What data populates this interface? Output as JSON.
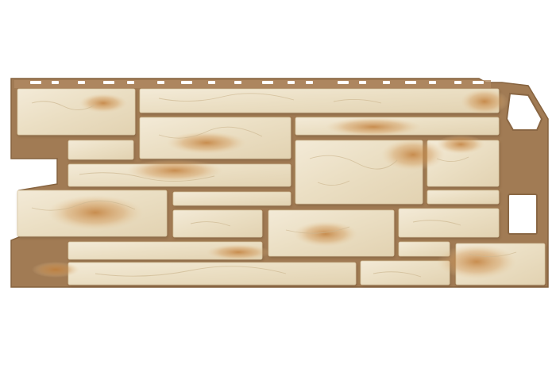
{
  "image": {
    "subject": "facade-stone-panel",
    "background_color": "#ffffff",
    "panel_color": "#a07a52",
    "panel_shadow_color": "#7d5c3b",
    "stone_base_color": "#ece0c6",
    "stone_light_color": "#f4ecd9",
    "stone_stain_color": "#c78a45",
    "nailing_hole_color": "#ffffff"
  }
}
